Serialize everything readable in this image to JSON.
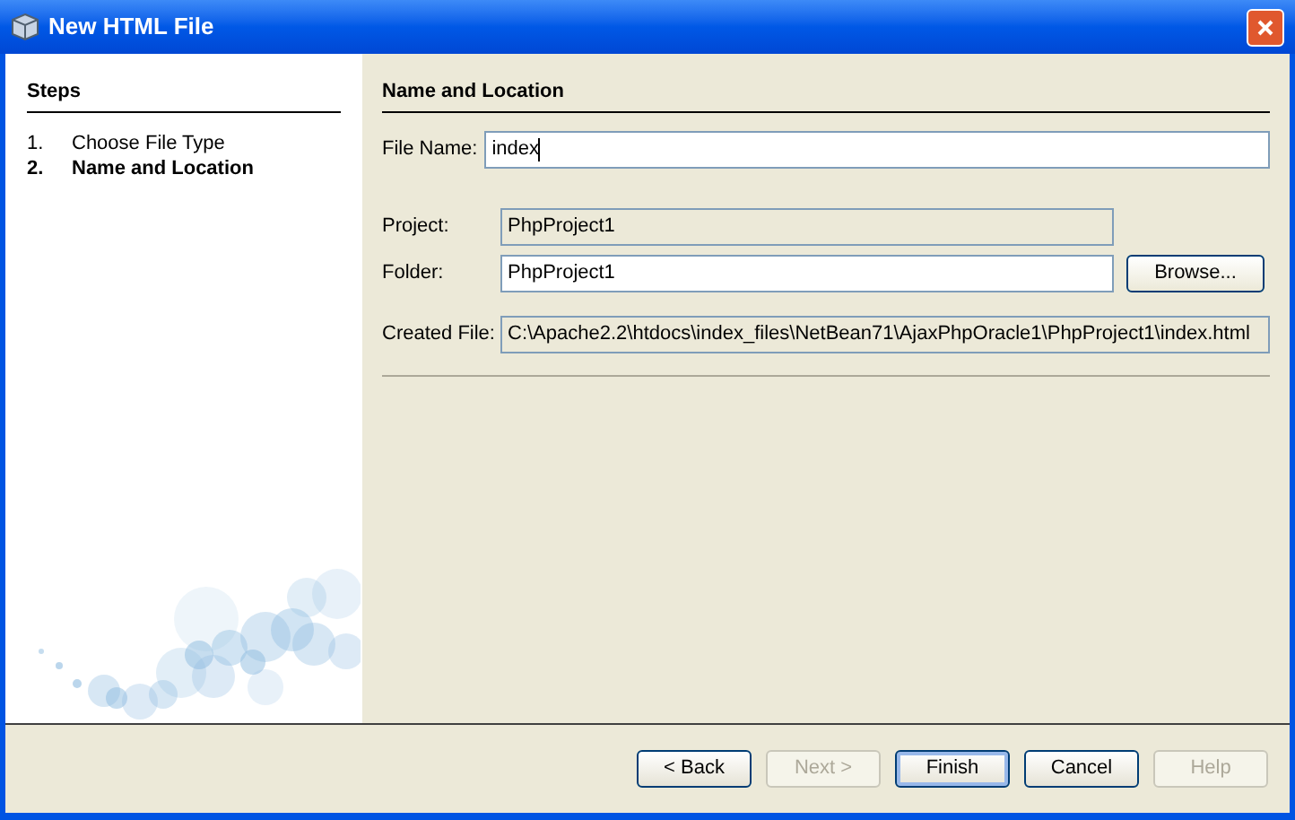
{
  "window": {
    "title": "New HTML File"
  },
  "steps": {
    "title": "Steps",
    "items": [
      {
        "number": "1.",
        "label": "Choose File Type",
        "selected": false
      },
      {
        "number": "2.",
        "label": "Name and Location",
        "selected": true
      }
    ]
  },
  "panel": {
    "title": "Name and Location",
    "file_name": {
      "label": "File Name:",
      "value": "index"
    },
    "fields": [
      {
        "label": "Project:",
        "value": "PhpProject1",
        "kind": "readonly"
      },
      {
        "label": "Folder:",
        "value": "PhpProject1",
        "kind": "editable",
        "button": "Browse..."
      },
      {
        "label": "Created File:",
        "value": "C:\\Apache2.2\\htdocs\\index_files\\NetBean71\\AjaxPhpOracle1\\PhpProject1\\index.html",
        "kind": "readonly"
      }
    ]
  },
  "buttons": [
    {
      "label": "< Back",
      "disabled": false,
      "default": false
    },
    {
      "label": "Next >",
      "disabled": true,
      "default": false
    },
    {
      "label": "Finish",
      "disabled": false,
      "default": true
    },
    {
      "label": "Cancel",
      "disabled": false,
      "default": false
    },
    {
      "label": "Help",
      "disabled": true,
      "default": false
    }
  ]
}
